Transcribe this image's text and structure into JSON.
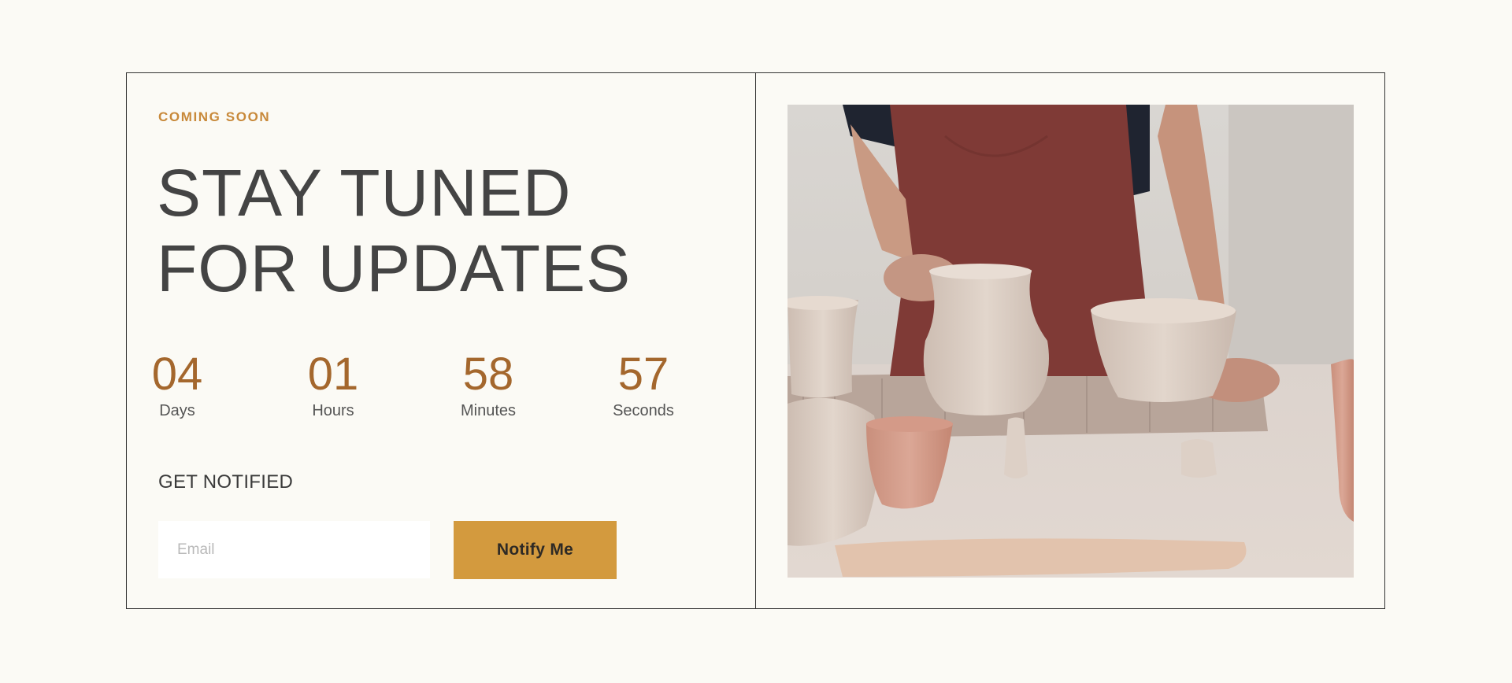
{
  "hero": {
    "eyebrow": "COMING SOON",
    "headline_line1": "STAY TUNED",
    "headline_line2": "FOR UPDATES"
  },
  "countdown": [
    {
      "value": "04",
      "label": "Days"
    },
    {
      "value": "01",
      "label": "Hours"
    },
    {
      "value": "58",
      "label": "Minutes"
    },
    {
      "value": "57",
      "label": "Seconds"
    }
  ],
  "signup": {
    "heading": "GET NOTIFIED",
    "email_placeholder": "Email",
    "button_label": "Notify Me"
  },
  "colors": {
    "background": "#fbfaf5",
    "accent": "#c8893a",
    "countdown_number": "#a4672d",
    "button": "#d39a3e",
    "text": "#444444"
  },
  "image": {
    "subject": "pottery-artisan-photo"
  }
}
